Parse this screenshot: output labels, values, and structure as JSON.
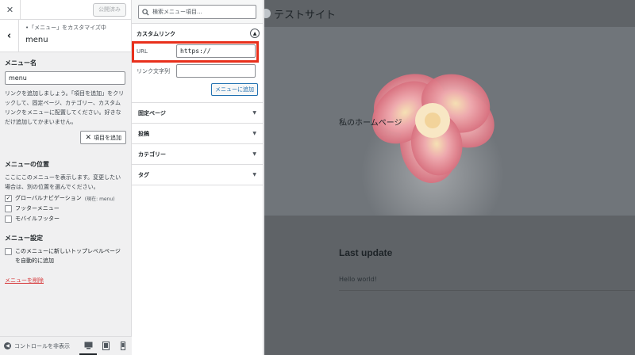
{
  "sidebar": {
    "close_icon": "close-icon",
    "publish_label": "公開済み",
    "breadcrumb": "•「メニュー」をカスタマイズ中",
    "title": "menu",
    "menu_name_label": "メニュー名",
    "menu_name_value": "menu",
    "description": "リンクを追加しましょう。「項目を追加」をクリックして、固定ページ、カテゴリー、カスタムリンクをメニューに配置してください。好きなだけ追加してかまいません。",
    "add_items_label": "項目を追加",
    "location_title": "メニューの位置",
    "location_desc": "ここにこのメニューを表示します。変更したい場合は、別の位置を選んでください。",
    "locations": [
      {
        "label": "グローバルナビゲーション",
        "note": "(現在: menu)",
        "checked": true
      },
      {
        "label": "フッターメニュー",
        "note": "",
        "checked": false
      },
      {
        "label": "モバイルフッター",
        "note": "",
        "checked": false
      }
    ],
    "settings_title": "メニュー設定",
    "auto_add_line1": "このメニューに新しいトップレベルページ",
    "auto_add_line2": "を自動的に追加",
    "delete_label": "メニューを削除",
    "hide_controls_label": "コントロールを非表示"
  },
  "panel": {
    "search_placeholder": "検索メニュー項目...",
    "custom_link_title": "カスタムリンク",
    "url_label": "URL",
    "url_value": "https://",
    "link_text_label": "リンク文字列",
    "link_text_value": "",
    "add_to_menu_label": "メニューに追加",
    "sections": [
      "固定ページ",
      "投稿",
      "カテゴリー",
      "タグ"
    ]
  },
  "preview": {
    "site_name": "テストサイト",
    "hero_text": "私のホームページ",
    "last_update_heading": "Last update",
    "post_title": "Hello world!"
  },
  "colors": {
    "highlight": "#e8301c",
    "link_blue": "#2271b1",
    "delete_red": "#d63638"
  }
}
